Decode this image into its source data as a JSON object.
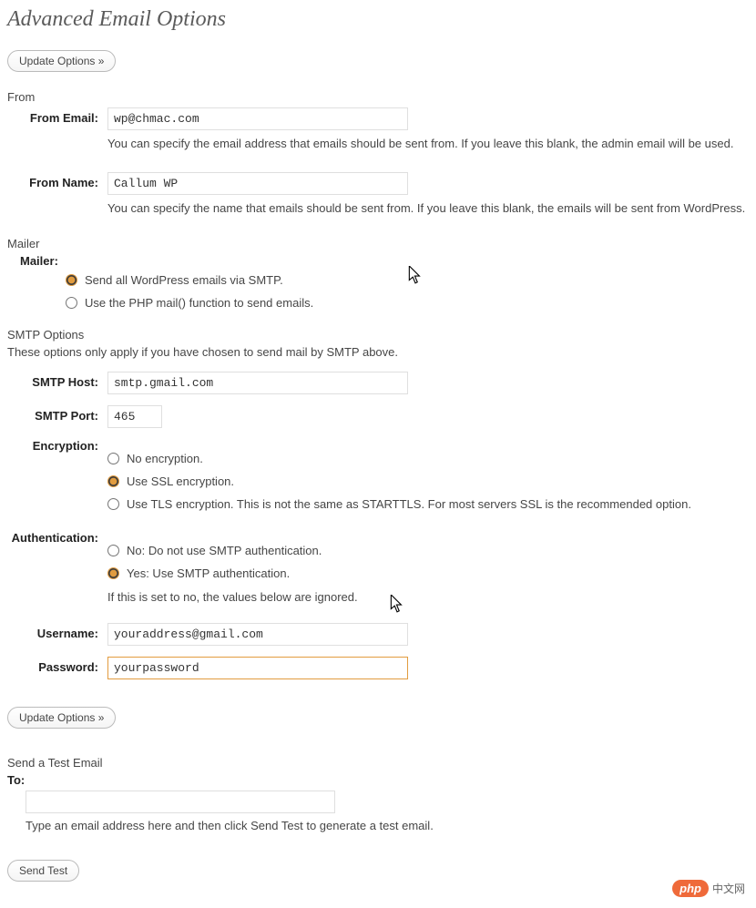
{
  "page_title": "Advanced Email Options",
  "buttons": {
    "update_options": "Update Options »",
    "send_test": "Send Test"
  },
  "sections": {
    "from": {
      "heading": "From",
      "email_label": "From Email:",
      "email_value": "wp@chmac.com",
      "email_desc": "You can specify the email address that emails should be sent from. If you leave this blank, the admin email will be used.",
      "name_label": "From Name:",
      "name_value": "Callum WP",
      "name_desc": "You can specify the name that emails should be sent from. If you leave this blank, the emails will be sent from WordPress."
    },
    "mailer": {
      "heading": "Mailer",
      "label": "Mailer:",
      "option_smtp": "Send all WordPress emails via SMTP.",
      "option_php": "Use the PHP mail() function to send emails."
    },
    "smtp": {
      "heading": "SMTP Options",
      "description": "These options only apply if you have chosen to send mail by SMTP above.",
      "host_label": "SMTP Host:",
      "host_value": "smtp.gmail.com",
      "port_label": "SMTP Port:",
      "port_value": "465",
      "encryption_label": "Encryption:",
      "enc_none": "No encryption.",
      "enc_ssl": "Use SSL encryption.",
      "enc_tls": "Use TLS encryption. This is not the same as STARTTLS. For most servers SSL is the recommended option.",
      "auth_label": "Authentication:",
      "auth_no": "No: Do not use SMTP authentication.",
      "auth_yes": "Yes: Use SMTP authentication.",
      "auth_note": "If this is set to no, the values below are ignored.",
      "user_label": "Username:",
      "user_value": "youraddress@gmail.com",
      "pass_label": "Password:",
      "pass_value": "yourpassword"
    },
    "test": {
      "heading": "Send a Test Email",
      "to_label": "To:",
      "to_value": "",
      "desc": "Type an email address here and then click Send Test to generate a test email."
    }
  },
  "watermark": {
    "badge": "php",
    "text": "中文网"
  }
}
